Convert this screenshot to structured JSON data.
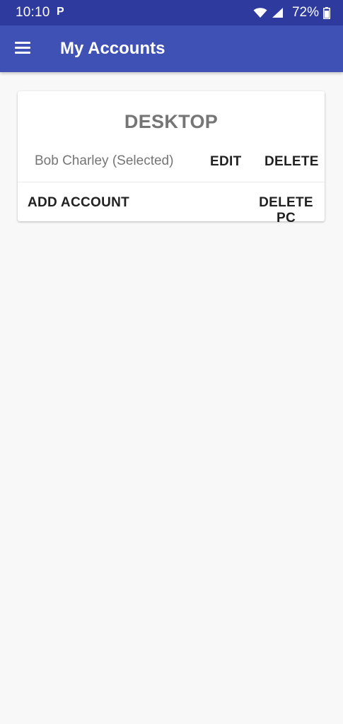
{
  "status_bar": {
    "time": "10:10",
    "notification_label": "P",
    "battery": "72%",
    "icons": [
      "wifi-icon",
      "cellular-signal-icon",
      "battery-icon"
    ]
  },
  "app_bar": {
    "title": "My Accounts",
    "menu_icon": "menu-icon"
  },
  "card": {
    "title": "DESKTOP",
    "account": {
      "name": "Bob Charley (Selected)",
      "edit_label": "EDIT",
      "delete_label": "DELETE"
    },
    "add_account_label": "ADD ACCOUNT",
    "delete_pc_label": "DELETE PC"
  },
  "colors": {
    "status_bar": "#2f3a9e",
    "app_bar": "#3f51b5",
    "background": "#f8f8f8",
    "card": "#ffffff",
    "muted_text": "#757575",
    "action_text": "#212121"
  }
}
